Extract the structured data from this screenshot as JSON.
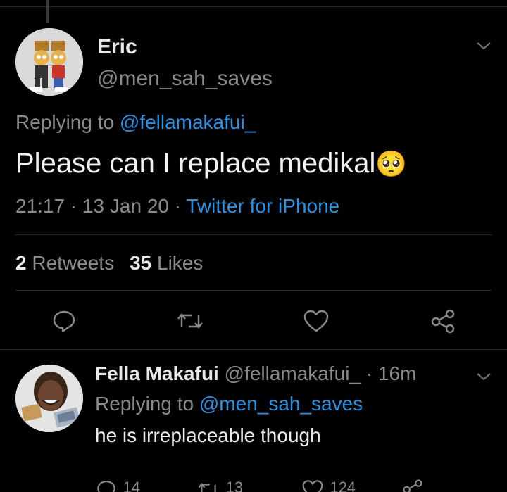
{
  "main_tweet": {
    "author_name": "Eric",
    "author_handle": "@men_sah_saves",
    "replying_prefix": "Replying to ",
    "replying_handle": "@fellamakafui_",
    "text": "Please can I replace medikal",
    "emoji": "🥺",
    "time": "21:17",
    "date_sep": " · ",
    "date": "13 Jan 20",
    "source_sep": " · ",
    "source": "Twitter for iPhone",
    "retweets_count": "2",
    "retweets_label": "Retweets",
    "likes_count": "35",
    "likes_label": "Likes"
  },
  "reply_tweet": {
    "author_name": "Fella Makafui",
    "author_handle": "@fellamakafui_",
    "time_sep": " · ",
    "time": "16m",
    "replying_prefix": "Replying to ",
    "replying_handle": "@men_sah_saves",
    "text": "he is irreplaceable though",
    "reply_count": "14",
    "retweet_count": "13",
    "like_count": "124"
  },
  "colors": {
    "background": "#000000",
    "link_blue": "#2f8fe0",
    "muted": "#8a8a8a"
  },
  "icons": [
    "reply-icon",
    "retweet-icon",
    "like-icon",
    "share-icon",
    "chevron-down-icon"
  ]
}
